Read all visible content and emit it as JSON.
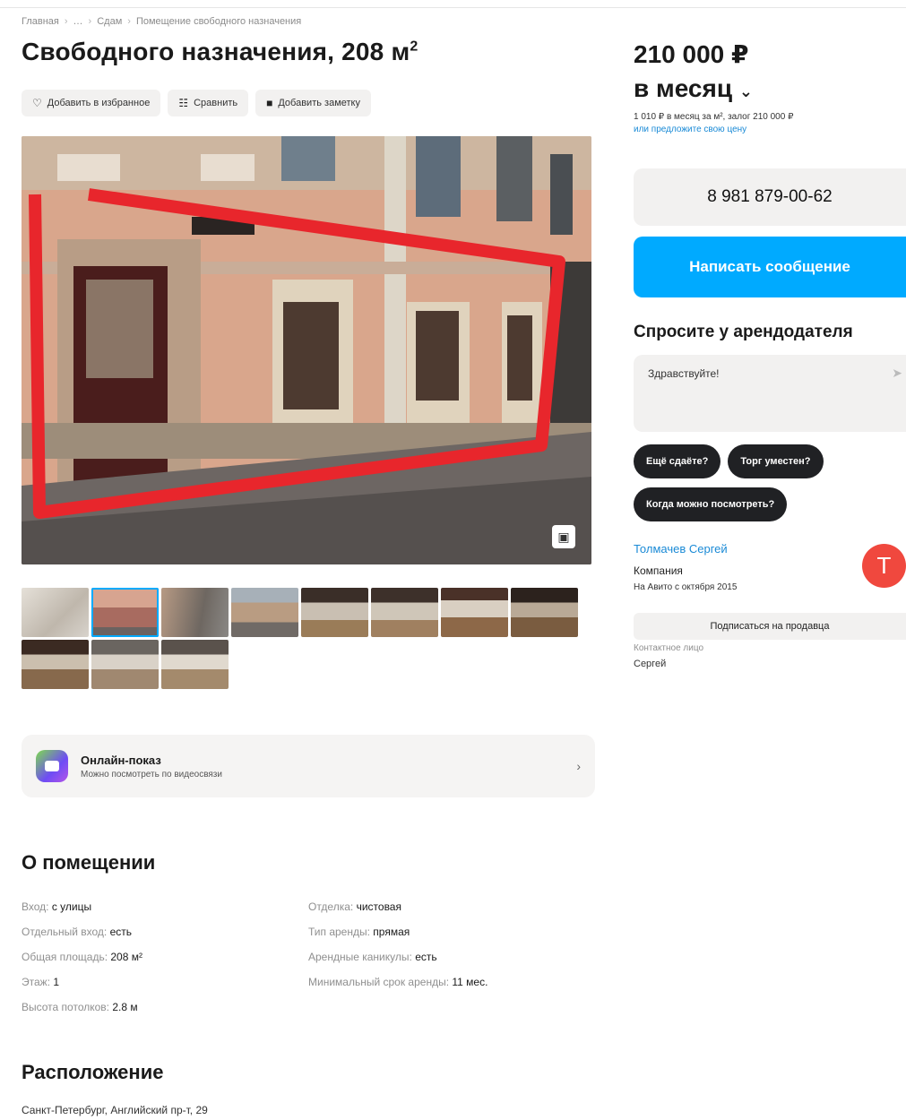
{
  "breadcrumbs": [
    "Главная",
    "…",
    "Сдам",
    "Помещение свободного назначения"
  ],
  "title": "Свободного назначения, 208 м",
  "title_sup": "2",
  "actions": {
    "favorite": "Добавить в избранное",
    "compare": "Сравнить",
    "note": "Добавить заметку"
  },
  "online": {
    "title": "Онлайн-показ",
    "subtitle": "Можно посмотреть по видеосвязи",
    "chevron": "›"
  },
  "about": {
    "title": "О помещении",
    "left": [
      {
        "k": "Вход: ",
        "v": "с улицы"
      },
      {
        "k": "Отдельный вход: ",
        "v": "есть"
      },
      {
        "k": "Общая площадь: ",
        "v": "208 м²"
      },
      {
        "k": "Этаж: ",
        "v": "1"
      },
      {
        "k": "Высота потолков: ",
        "v": "2.8 м"
      }
    ],
    "right": [
      {
        "k": "Отделка: ",
        "v": "чистовая"
      },
      {
        "k": "Тип аренды: ",
        "v": "прямая"
      },
      {
        "k": "Арендные каникулы: ",
        "v": "есть"
      },
      {
        "k": "Минимальный срок аренды: ",
        "v": "11 мес."
      }
    ]
  },
  "location": {
    "title": "Расположение",
    "address": "Санкт-Петербург, Английский пр-т, 29"
  },
  "price": {
    "amount": "210 000 ₽",
    "period": "в месяц",
    "note_line1": "1 010 ₽ в месяц за м², залог 210 000 ₽",
    "note_link": "или предложите свою цену"
  },
  "phone": "8 981 879-00-62",
  "message_button": "Написать сообщение",
  "ask": {
    "title": "Спросите у арендодателя",
    "input_text": "Здравствуйте!",
    "chips": [
      "Ещё сдаёте?",
      "Торг уместен?",
      "Когда можно посмотреть?"
    ]
  },
  "seller": {
    "name": "Толмачев Сергей",
    "type": "Компания",
    "since": "На Авито с октября 2015",
    "avatar_letter": "Т",
    "subscribe": "Подписаться на продавца",
    "contact_label": "Контактное лицо",
    "contact_name": "Сергей"
  },
  "colors": {
    "accent_blue": "#00aaff",
    "link_blue": "#1a8ad6",
    "avatar_red": "#f0483e",
    "chip_dark": "#202124",
    "highlight_red": "#e8262c"
  },
  "icons": {
    "favorite": "heart-icon",
    "compare": "compare-icon",
    "note": "note-icon",
    "gallery": "gallery-icon",
    "send": "send-icon",
    "chevron_down": "chevron-down-icon"
  }
}
